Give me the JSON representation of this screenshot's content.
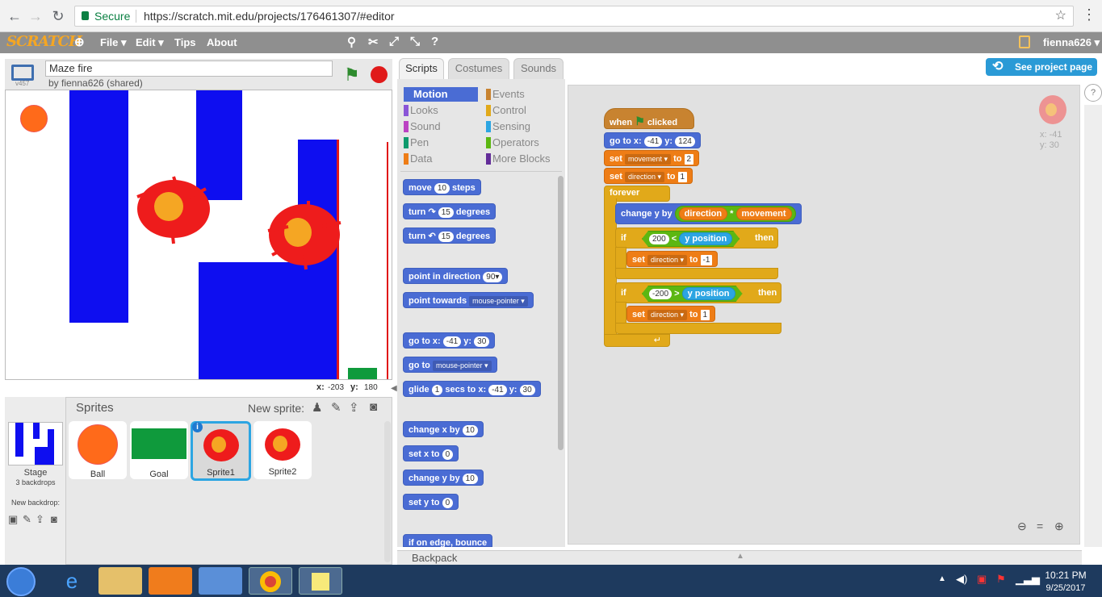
{
  "browser": {
    "secure_label": "Secure",
    "url": "https://scratch.mit.edu/projects/176461307/#editor"
  },
  "menubar": {
    "logo": "SCRATCH",
    "items": [
      "File ▾",
      "Edit ▾",
      "Tips",
      "About"
    ],
    "user": "fienna626 ▾"
  },
  "project": {
    "title": "Maze fire",
    "byline": "by fienna626 (shared)",
    "version": "v457"
  },
  "stage": {
    "coords_x_label": "x:",
    "coords_x": "-203",
    "coords_y_label": "y:",
    "coords_y": "180"
  },
  "sprites": {
    "header": "Sprites",
    "new_sprite": "New sprite:",
    "stage_label": "Stage",
    "backdrops": "3 backdrops",
    "new_backdrop": "New backdrop:",
    "items": [
      "Ball",
      "Goal",
      "Sprite1",
      "Sprite2"
    ]
  },
  "tabs": [
    "Scripts",
    "Costumes",
    "Sounds"
  ],
  "see_project": "See project page",
  "categories": {
    "left": [
      "Motion",
      "Looks",
      "Sound",
      "Pen",
      "Data"
    ],
    "right": [
      "Events",
      "Control",
      "Sensing",
      "Operators",
      "More Blocks"
    ]
  },
  "palette": {
    "move": [
      "move",
      "10",
      "steps"
    ],
    "turn_cw": [
      "turn",
      "15",
      "degrees"
    ],
    "turn_ccw": [
      "turn",
      "15",
      "degrees"
    ],
    "point_dir": [
      "point in direction",
      "90▾"
    ],
    "point_towards": [
      "point towards",
      "mouse-pointer ▾"
    ],
    "goto_xy": [
      "go to x:",
      "-41",
      "y:",
      "30"
    ],
    "goto": [
      "go to",
      "mouse-pointer ▾"
    ],
    "glide": [
      "glide",
      "1",
      "secs to x:",
      "-41",
      "y:",
      "30"
    ],
    "change_x": [
      "change x by",
      "10"
    ],
    "set_x": [
      "set x to",
      "0"
    ],
    "change_y": [
      "change y by",
      "10"
    ],
    "set_y": [
      "set y to",
      "0"
    ],
    "bounce": "if on edge, bounce"
  },
  "script": {
    "hat": [
      "when",
      "clicked"
    ],
    "goto": [
      "go to x:",
      "-41",
      "y:",
      "124"
    ],
    "set1": [
      "set",
      "movement ▾",
      "to",
      "2"
    ],
    "set2": [
      "set",
      "direction ▾",
      "to",
      "1"
    ],
    "forever": "forever",
    "change": [
      "change y by",
      "direction",
      "*",
      "movement"
    ],
    "if1": [
      "if",
      "200",
      "<",
      "y position",
      "then"
    ],
    "set3": [
      "set",
      "direction ▾",
      "to",
      "-1"
    ],
    "if2": [
      "if",
      "-200",
      ">",
      "y position",
      "then"
    ],
    "set4": [
      "set",
      "direction ▾",
      "to",
      "1"
    ]
  },
  "sprite_info": {
    "x": "x: -41",
    "y": "y: 30"
  },
  "backpack": "Backpack",
  "clock": {
    "time": "10:21 PM",
    "date": "9/25/2017"
  }
}
